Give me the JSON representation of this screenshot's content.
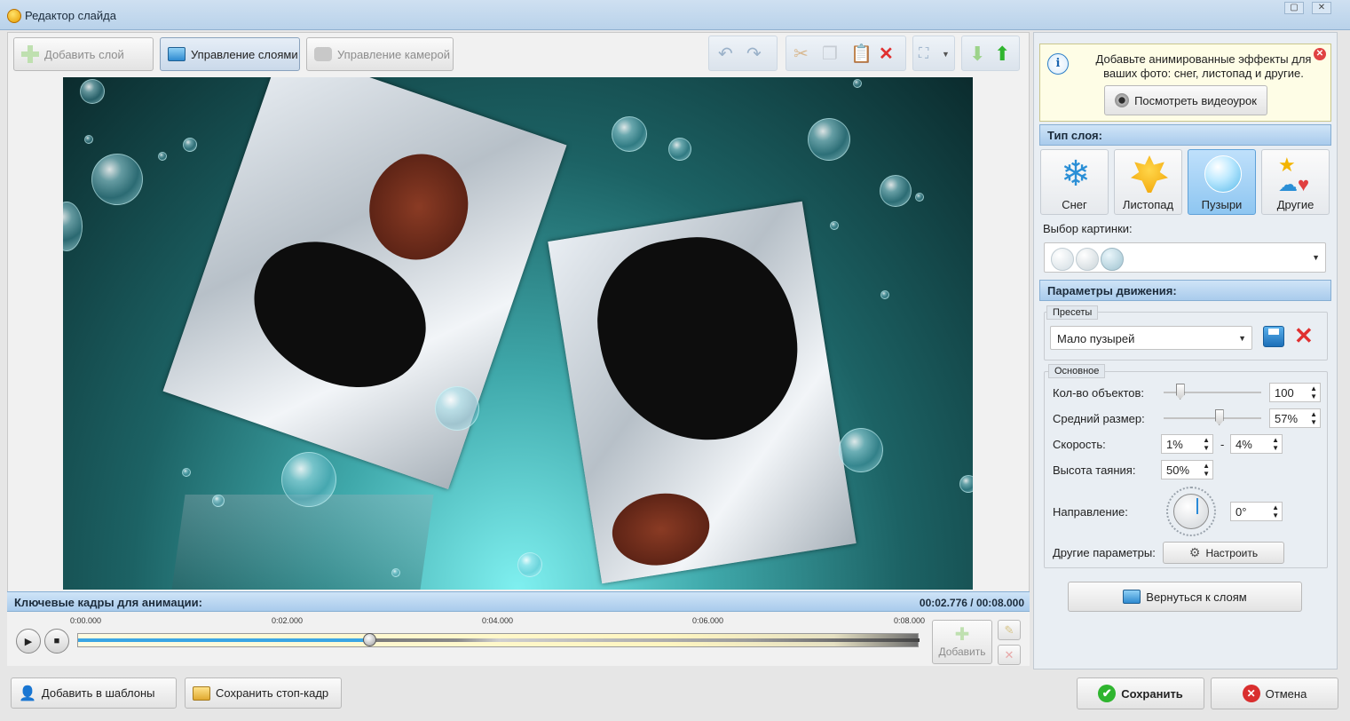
{
  "window": {
    "title": "Редактор слайда"
  },
  "toolbar": {
    "add_layer": "Добавить слой",
    "manage_layers": "Управление слоями",
    "manage_camera": "Управление камерой"
  },
  "keyframes": {
    "title": "Ключевые кадры для анимации:",
    "time": "00:02.776 / 00:08.000",
    "ticks": [
      "0:00.000",
      "0:02.000",
      "0:04.000",
      "0:06.000",
      "0:08.000"
    ],
    "progress_fraction": 0.347,
    "add_label": "Добавить"
  },
  "hint": {
    "text": "Добавьте анимированные эффекты для ваших фото: снег, листопад и другие.",
    "video_button": "Посмотреть видеоурок"
  },
  "layer_type": {
    "title": "Тип слоя:",
    "tiles": [
      {
        "label": "Снег",
        "icon": "snowflake-icon",
        "selected": false
      },
      {
        "label": "Листопад",
        "icon": "leaf-icon",
        "selected": false
      },
      {
        "label": "Пузыри",
        "icon": "bubble-icon",
        "selected": true
      },
      {
        "label": "Другие",
        "icon": "star-heart-icon",
        "selected": false
      }
    ],
    "picture_label": "Выбор картинки:"
  },
  "motion": {
    "title": "Параметры движения:",
    "presets_caption": "Пресеты",
    "preset_value": "Мало пузырей",
    "basic_caption": "Основное",
    "count_label": "Кол-во объектов:",
    "count_value": "100",
    "count_fraction": 0.17,
    "size_label": "Средний размер:",
    "size_value": "57%",
    "size_fraction": 0.57,
    "speed_label": "Скорость:",
    "speed_min": "1%",
    "speed_dash": "-",
    "speed_max": "4%",
    "melt_label": "Высота таяния:",
    "melt_value": "50%",
    "direction_label": "Направление:",
    "direction_value": "0°",
    "other_label": "Другие параметры:",
    "configure_button": "Настроить"
  },
  "back_button": "Вернуться к слоям",
  "footer": {
    "add_template": "Добавить в шаблоны",
    "save_frame": "Сохранить стоп-кадр",
    "save": "Сохранить",
    "cancel": "Отмена"
  },
  "colors": {
    "accent": "#3ba6e4",
    "header": "#a9cbec",
    "save_icon": "#2fb52f",
    "cancel_icon": "#d92e2e"
  }
}
